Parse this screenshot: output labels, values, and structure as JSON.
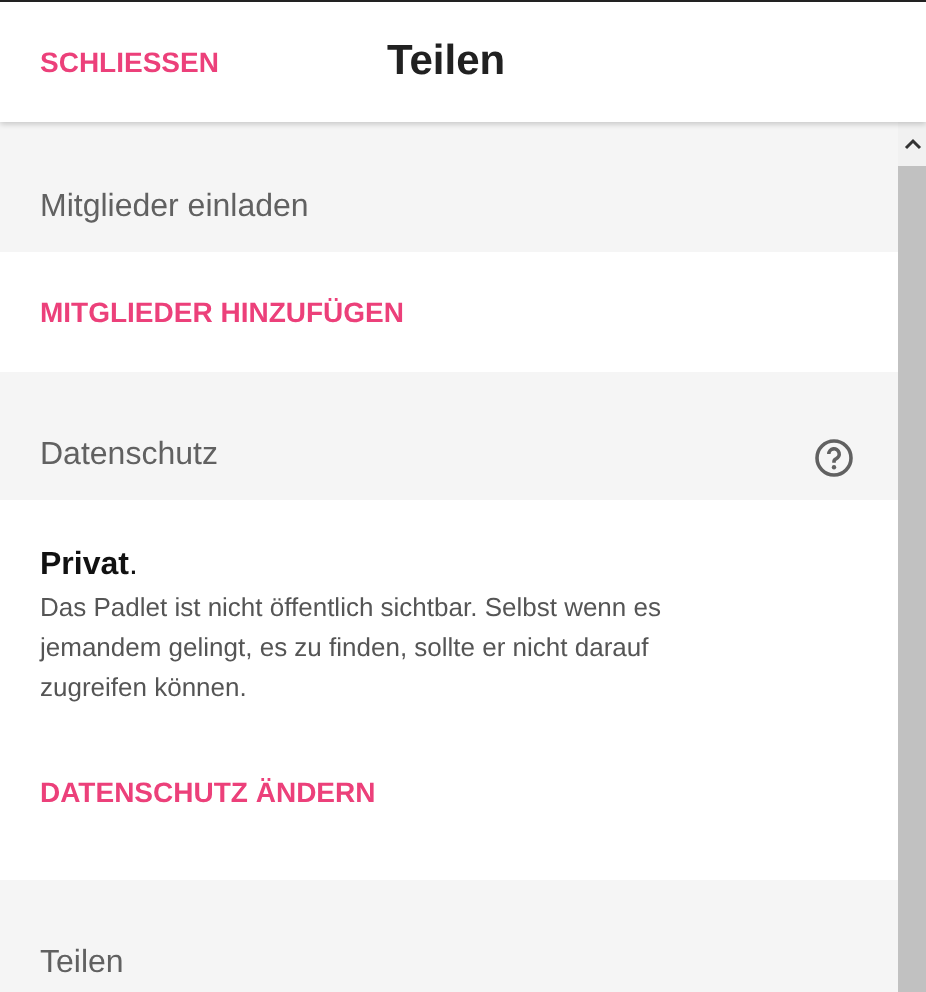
{
  "header": {
    "close": "SCHLIESSEN",
    "title": "Teilen"
  },
  "sections": [
    {
      "kind": "heading",
      "text": "Mitglieder einladen"
    },
    {
      "kind": "link",
      "text": "MITGLIEDER HINZUFÜGEN"
    },
    {
      "kind": "heading",
      "text": "Datenschutz",
      "help": true
    },
    {
      "kind": "info",
      "title": "**Privat**.",
      "text": "Das Padlet ist nicht öffentlich sichtbar. Selbst wenn es jemandem gelingt, es zu finden, sollte er nicht darauf zugreifen können."
    },
    {
      "kind": "link",
      "text": "DATENSCHUTZ ÄNDERN"
    },
    {
      "kind": "heading",
      "text": "Teilen"
    }
  ]
}
